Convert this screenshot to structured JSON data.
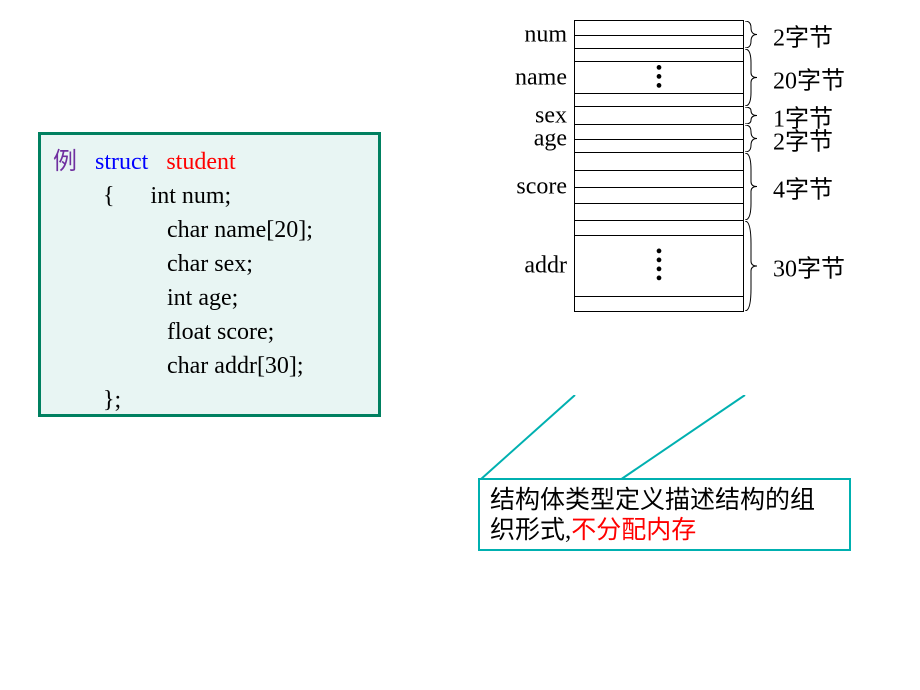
{
  "code": {
    "example_label": "例",
    "keyword_struct": "struct",
    "struct_name": "student",
    "open_brace": "{",
    "line_num": "int num;",
    "line_name": "char  name[20];",
    "line_sex": "char sex;",
    "line_age": "int age;",
    "line_score": "float score;",
    "line_addr": "char addr[30];",
    "close_brace": "};"
  },
  "memory": {
    "fields": {
      "num": {
        "label": "num",
        "size": "2字节"
      },
      "name": {
        "label": "name",
        "size": "20字节"
      },
      "sex": {
        "label": "sex",
        "size": "1字节"
      },
      "age": {
        "label": "age",
        "size": "2字节"
      },
      "score": {
        "label": "score",
        "size": "4字节"
      },
      "addr": {
        "label": "addr",
        "size": "30字节"
      }
    }
  },
  "callout": {
    "text_part1": "结构体类型定义描述结构的组织形式,",
    "text_part2": "不分配内存"
  }
}
